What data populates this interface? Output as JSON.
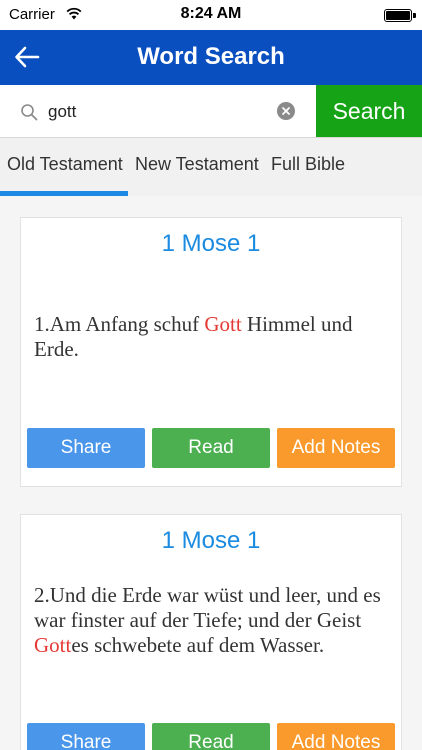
{
  "status_bar": {
    "carrier": "Carrier",
    "time": "8:24 AM"
  },
  "header": {
    "title": "Word Search",
    "back_icon": "arrow-left-icon"
  },
  "search": {
    "value": "gott",
    "placeholder": "",
    "button_label": "Search"
  },
  "tabs": [
    {
      "label": "Old Testament",
      "active": true
    },
    {
      "label": "New Testament",
      "active": false
    },
    {
      "label": "Full Bible",
      "active": false
    }
  ],
  "results": [
    {
      "reference": "1 Mose 1",
      "verse_parts": [
        "1.Am Anfang schuf ",
        "Gott",
        " Himmel und Erde."
      ],
      "actions": {
        "share": "Share",
        "read": "Read",
        "notes": "Add Notes"
      }
    },
    {
      "reference": "1 Mose 1",
      "verse_parts": [
        "2.Und die Erde war wüst und leer, und es war finster auf der Tiefe; und der Geist ",
        "Gott",
        "es schwebete auf dem Wasser."
      ],
      "actions": {
        "share": "Share",
        "read": "Read",
        "notes": "Add Notes"
      }
    }
  ],
  "colors": {
    "header": "#0a4fc0",
    "search_button": "#16a416",
    "tab_indicator": "#1e88e5",
    "reference": "#1a8be0",
    "highlight": "#e53935",
    "share": "#4a96ea",
    "read": "#4caf50",
    "notes": "#fb9a2c"
  }
}
